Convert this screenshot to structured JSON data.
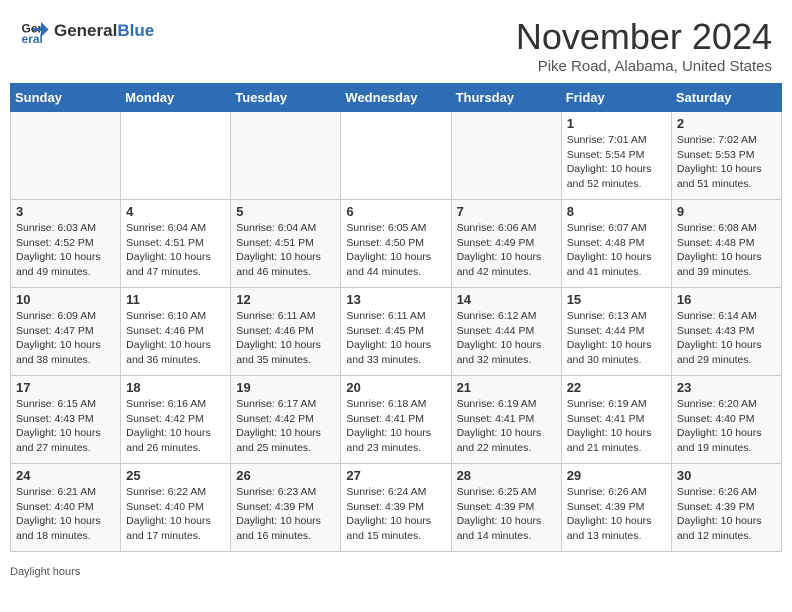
{
  "header": {
    "logo_general": "General",
    "logo_blue": "Blue",
    "month_title": "November 2024",
    "location": "Pike Road, Alabama, United States"
  },
  "days_of_week": [
    "Sunday",
    "Monday",
    "Tuesday",
    "Wednesday",
    "Thursday",
    "Friday",
    "Saturday"
  ],
  "footer": {
    "note": "Daylight hours"
  },
  "weeks": [
    [
      {
        "day": "",
        "info": ""
      },
      {
        "day": "",
        "info": ""
      },
      {
        "day": "",
        "info": ""
      },
      {
        "day": "",
        "info": ""
      },
      {
        "day": "",
        "info": ""
      },
      {
        "day": "1",
        "info": "Sunrise: 7:01 AM\nSunset: 5:54 PM\nDaylight: 10 hours\nand 52 minutes."
      },
      {
        "day": "2",
        "info": "Sunrise: 7:02 AM\nSunset: 5:53 PM\nDaylight: 10 hours\nand 51 minutes."
      }
    ],
    [
      {
        "day": "3",
        "info": "Sunrise: 6:03 AM\nSunset: 4:52 PM\nDaylight: 10 hours\nand 49 minutes."
      },
      {
        "day": "4",
        "info": "Sunrise: 6:04 AM\nSunset: 4:51 PM\nDaylight: 10 hours\nand 47 minutes."
      },
      {
        "day": "5",
        "info": "Sunrise: 6:04 AM\nSunset: 4:51 PM\nDaylight: 10 hours\nand 46 minutes."
      },
      {
        "day": "6",
        "info": "Sunrise: 6:05 AM\nSunset: 4:50 PM\nDaylight: 10 hours\nand 44 minutes."
      },
      {
        "day": "7",
        "info": "Sunrise: 6:06 AM\nSunset: 4:49 PM\nDaylight: 10 hours\nand 42 minutes."
      },
      {
        "day": "8",
        "info": "Sunrise: 6:07 AM\nSunset: 4:48 PM\nDaylight: 10 hours\nand 41 minutes."
      },
      {
        "day": "9",
        "info": "Sunrise: 6:08 AM\nSunset: 4:48 PM\nDaylight: 10 hours\nand 39 minutes."
      }
    ],
    [
      {
        "day": "10",
        "info": "Sunrise: 6:09 AM\nSunset: 4:47 PM\nDaylight: 10 hours\nand 38 minutes."
      },
      {
        "day": "11",
        "info": "Sunrise: 6:10 AM\nSunset: 4:46 PM\nDaylight: 10 hours\nand 36 minutes."
      },
      {
        "day": "12",
        "info": "Sunrise: 6:11 AM\nSunset: 4:46 PM\nDaylight: 10 hours\nand 35 minutes."
      },
      {
        "day": "13",
        "info": "Sunrise: 6:11 AM\nSunset: 4:45 PM\nDaylight: 10 hours\nand 33 minutes."
      },
      {
        "day": "14",
        "info": "Sunrise: 6:12 AM\nSunset: 4:44 PM\nDaylight: 10 hours\nand 32 minutes."
      },
      {
        "day": "15",
        "info": "Sunrise: 6:13 AM\nSunset: 4:44 PM\nDaylight: 10 hours\nand 30 minutes."
      },
      {
        "day": "16",
        "info": "Sunrise: 6:14 AM\nSunset: 4:43 PM\nDaylight: 10 hours\nand 29 minutes."
      }
    ],
    [
      {
        "day": "17",
        "info": "Sunrise: 6:15 AM\nSunset: 4:43 PM\nDaylight: 10 hours\nand 27 minutes."
      },
      {
        "day": "18",
        "info": "Sunrise: 6:16 AM\nSunset: 4:42 PM\nDaylight: 10 hours\nand 26 minutes."
      },
      {
        "day": "19",
        "info": "Sunrise: 6:17 AM\nSunset: 4:42 PM\nDaylight: 10 hours\nand 25 minutes."
      },
      {
        "day": "20",
        "info": "Sunrise: 6:18 AM\nSunset: 4:41 PM\nDaylight: 10 hours\nand 23 minutes."
      },
      {
        "day": "21",
        "info": "Sunrise: 6:19 AM\nSunset: 4:41 PM\nDaylight: 10 hours\nand 22 minutes."
      },
      {
        "day": "22",
        "info": "Sunrise: 6:19 AM\nSunset: 4:41 PM\nDaylight: 10 hours\nand 21 minutes."
      },
      {
        "day": "23",
        "info": "Sunrise: 6:20 AM\nSunset: 4:40 PM\nDaylight: 10 hours\nand 19 minutes."
      }
    ],
    [
      {
        "day": "24",
        "info": "Sunrise: 6:21 AM\nSunset: 4:40 PM\nDaylight: 10 hours\nand 18 minutes."
      },
      {
        "day": "25",
        "info": "Sunrise: 6:22 AM\nSunset: 4:40 PM\nDaylight: 10 hours\nand 17 minutes."
      },
      {
        "day": "26",
        "info": "Sunrise: 6:23 AM\nSunset: 4:39 PM\nDaylight: 10 hours\nand 16 minutes."
      },
      {
        "day": "27",
        "info": "Sunrise: 6:24 AM\nSunset: 4:39 PM\nDaylight: 10 hours\nand 15 minutes."
      },
      {
        "day": "28",
        "info": "Sunrise: 6:25 AM\nSunset: 4:39 PM\nDaylight: 10 hours\nand 14 minutes."
      },
      {
        "day": "29",
        "info": "Sunrise: 6:26 AM\nSunset: 4:39 PM\nDaylight: 10 hours\nand 13 minutes."
      },
      {
        "day": "30",
        "info": "Sunrise: 6:26 AM\nSunset: 4:39 PM\nDaylight: 10 hours\nand 12 minutes."
      }
    ]
  ]
}
